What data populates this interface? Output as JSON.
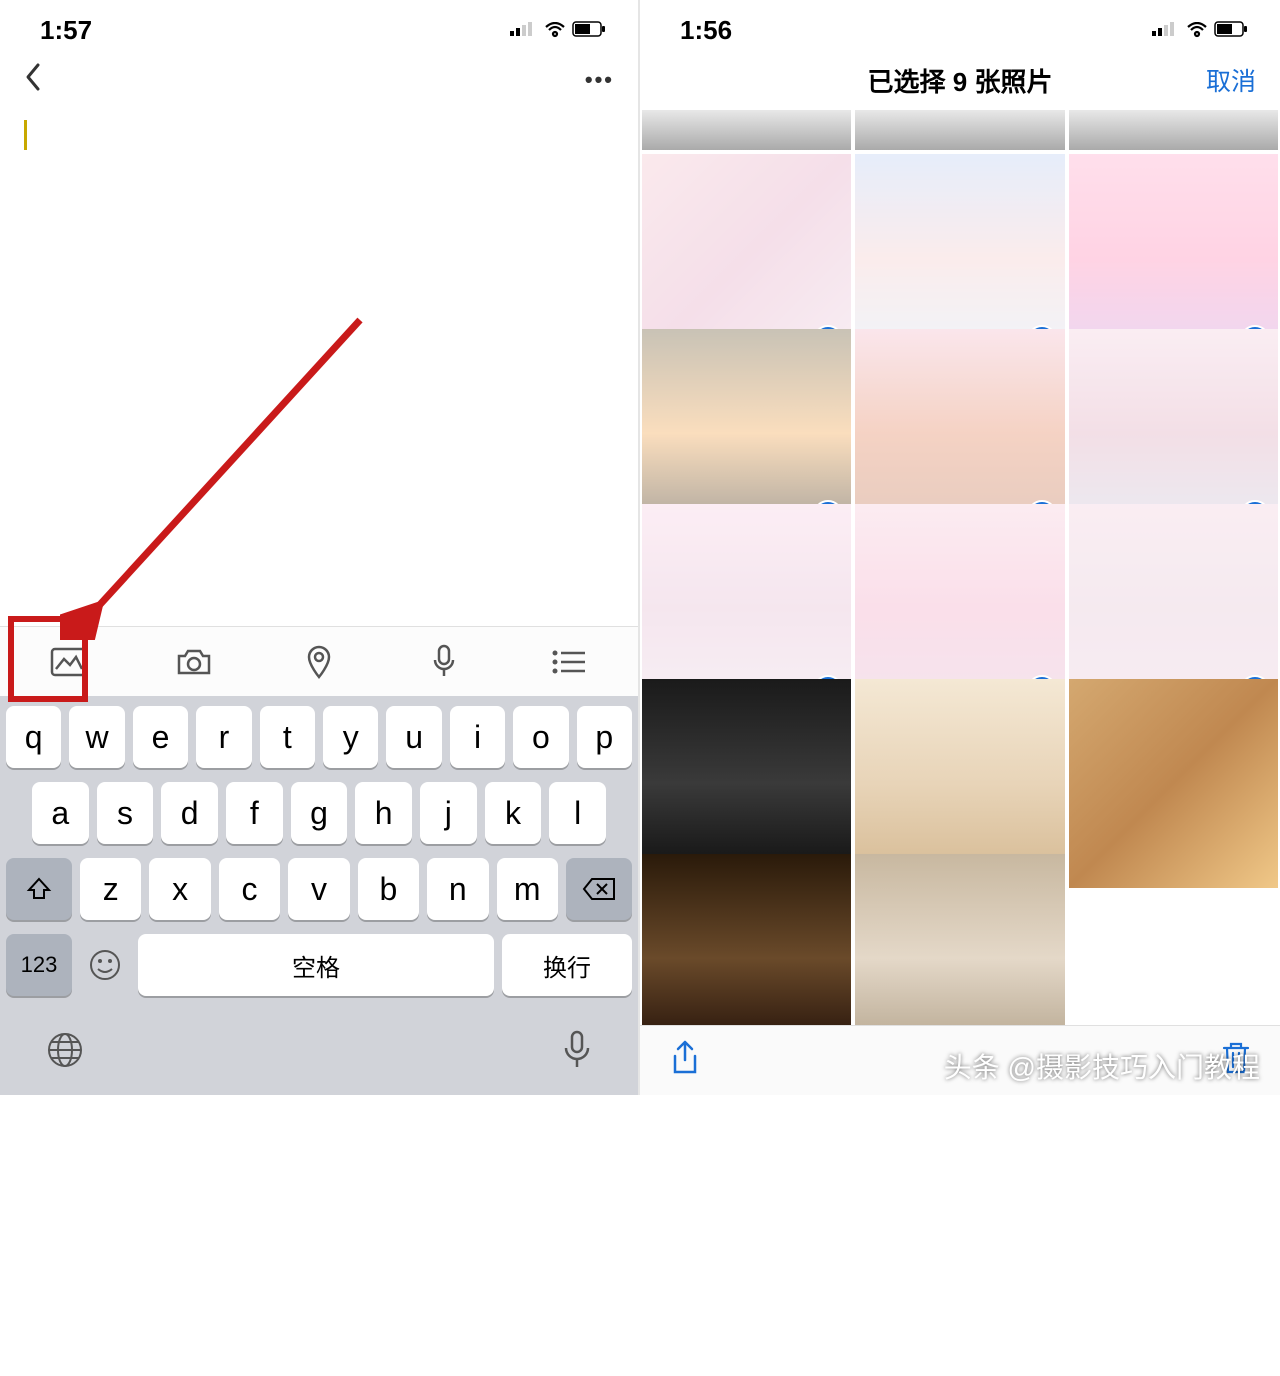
{
  "left": {
    "status_time": "1:57",
    "toolbar": {
      "image": "image-icon",
      "camera": "camera-icon",
      "location": "location-icon",
      "mic": "mic-icon",
      "list": "list-icon"
    },
    "keyboard": {
      "row1": [
        "q",
        "w",
        "e",
        "r",
        "t",
        "y",
        "u",
        "i",
        "o",
        "p"
      ],
      "row2": [
        "a",
        "s",
        "d",
        "f",
        "g",
        "h",
        "j",
        "k",
        "l"
      ],
      "row3": [
        "z",
        "x",
        "c",
        "v",
        "b",
        "n",
        "m"
      ],
      "num": "123",
      "space": "空格",
      "enter": "换行"
    }
  },
  "right": {
    "status_time": "1:56",
    "title": "已选择 9 张照片",
    "cancel": "取消",
    "thumbs": [
      {
        "cls": "g1",
        "short": true,
        "selected": false
      },
      {
        "cls": "g1",
        "short": true,
        "selected": false
      },
      {
        "cls": "g1",
        "short": true,
        "selected": false
      },
      {
        "cls": "g2",
        "selected": true
      },
      {
        "cls": "g3",
        "selected": true
      },
      {
        "cls": "g4",
        "selected": true
      },
      {
        "cls": "g5",
        "selected": true
      },
      {
        "cls": "g6",
        "selected": true
      },
      {
        "cls": "g7",
        "selected": true
      },
      {
        "cls": "g8",
        "selected": true
      },
      {
        "cls": "g9",
        "selected": true
      },
      {
        "cls": "g10",
        "selected": true
      },
      {
        "cls": "g11",
        "selected": false
      },
      {
        "cls": "g12",
        "selected": false
      },
      {
        "cls": "g13",
        "selected": false
      },
      {
        "cls": "g14",
        "selected": false
      },
      {
        "cls": "g15",
        "selected": false
      }
    ]
  },
  "watermark": "头条 @摄影技巧入门教程"
}
